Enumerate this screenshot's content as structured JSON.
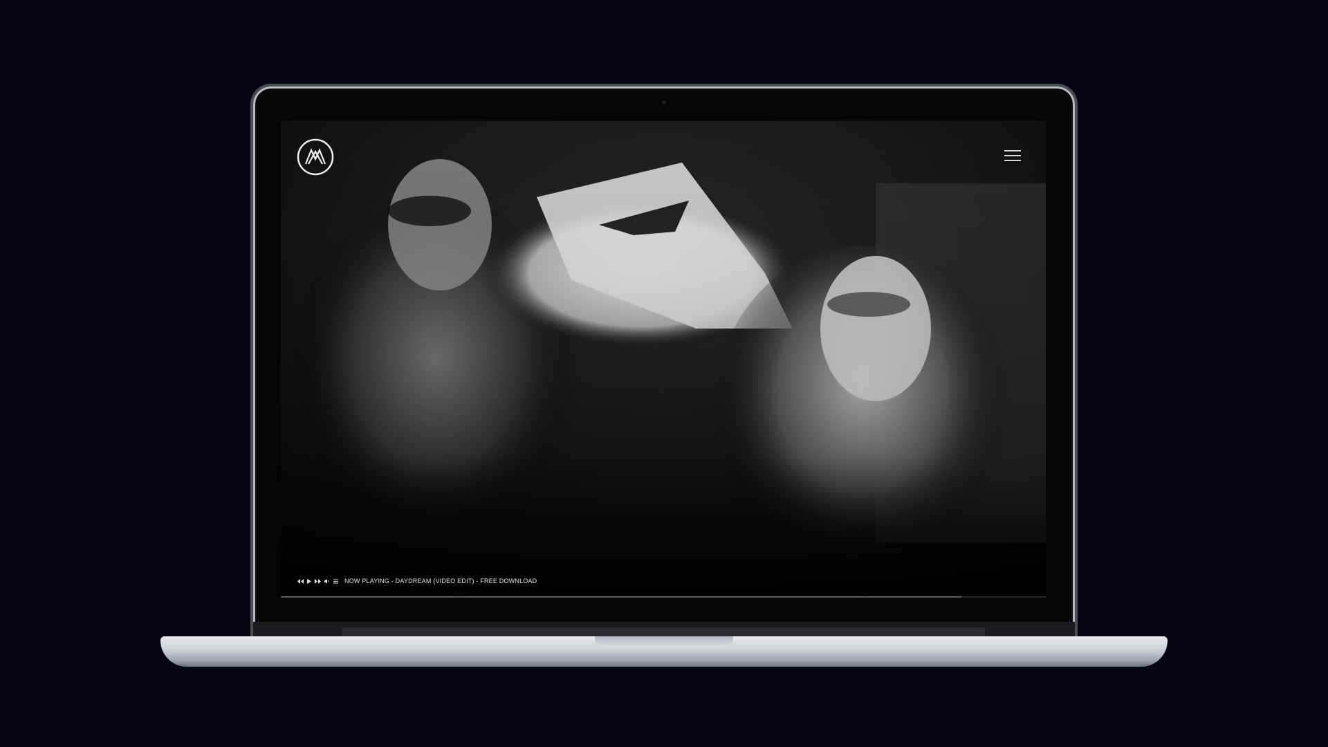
{
  "site": {
    "logo_icon": "band-logo-icon",
    "menu_icon": "hamburger-menu-icon"
  },
  "player": {
    "controls": [
      "rewind-icon",
      "play-icon",
      "fast-forward-icon",
      "volume-icon",
      "playlist-icon"
    ],
    "now_playing_text": "NOW PLAYING - DAYDREAM (VIDEO EDIT) - FREE DOWNLOAD",
    "progress": 0.89
  },
  "colors": {
    "background": "#060713",
    "screen": "#000000",
    "text": "#e6e6e6"
  }
}
